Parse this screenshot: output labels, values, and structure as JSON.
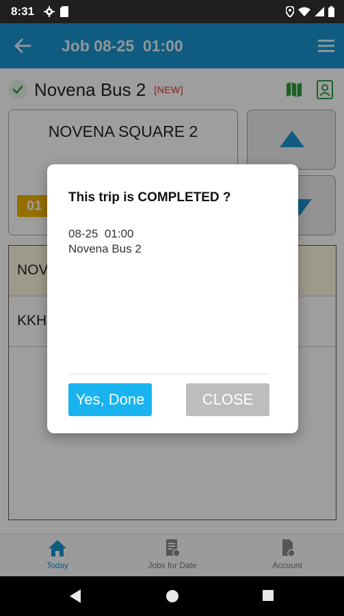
{
  "status_bar": {
    "time": "8:31",
    "icons": [
      "gear-icon",
      "sd-card-icon",
      "location-icon",
      "wifi-icon",
      "signal-icon",
      "battery-icon"
    ]
  },
  "app_bar": {
    "title": "Job 08-25  01:00",
    "icons": [
      "back-arrow-icon",
      "menu-icon"
    ],
    "color": "#1a95cf"
  },
  "job": {
    "name": "Novena Bus 2",
    "badge": "[NEW]",
    "status_icon": "check-circle-icon",
    "actions": [
      "map-icon",
      "contact-icon"
    ]
  },
  "stop_card": {
    "title": "NOVENA SQUARE 2",
    "time_chip": "01"
  },
  "navigation": {
    "up_icon": "triangle-up-icon",
    "down_icon": "triangle-down-icon"
  },
  "list": {
    "rows": [
      {
        "label": "NOV"
      },
      {
        "label": "KKH"
      }
    ]
  },
  "bottom_nav": {
    "tabs": [
      {
        "label": "Today",
        "icon": "home-icon",
        "active": true
      },
      {
        "label": "Jobs for Date",
        "icon": "document-icon",
        "active": false
      },
      {
        "label": "Account",
        "icon": "account-icon",
        "active": false
      }
    ]
  },
  "dialog": {
    "title": "This trip is COMPLETED ?",
    "line1": "08-25  01:00",
    "line2": "Novena Bus 2",
    "confirm_label": "Yes, Done",
    "close_label": "CLOSE",
    "confirm_color": "#19b4f0"
  }
}
